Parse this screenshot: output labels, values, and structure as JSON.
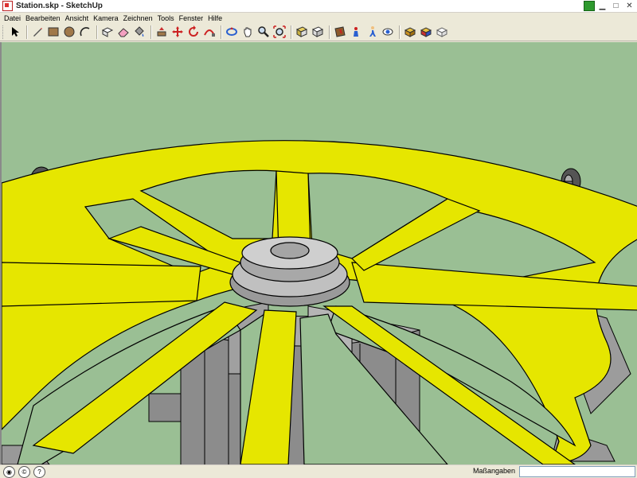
{
  "window": {
    "title": "Station.skp - SketchUp"
  },
  "menu": [
    "Datei",
    "Bearbeiten",
    "Ansicht",
    "Kamera",
    "Zeichnen",
    "Tools",
    "Fenster",
    "Hilfe"
  ],
  "toolbar": {
    "groups": [
      [
        "select-icon"
      ],
      [
        "pencil-icon",
        "rectangle-icon",
        "circle-icon",
        "arc-icon"
      ],
      [
        "make-component-icon",
        "eraser-icon",
        "paint-bucket-icon"
      ],
      [
        "push-pull-icon",
        "move-icon",
        "rotate-icon",
        "follow-me-icon"
      ],
      [
        "orbit-icon",
        "pan-icon",
        "zoom-icon",
        "zoom-extents-icon"
      ],
      [
        "get-models-icon",
        "share-model-icon"
      ],
      [
        "section-plane-icon",
        "position-camera-icon",
        "walk-icon",
        "look-around-icon"
      ],
      [
        "component-icon",
        "materials-icon",
        "styles-icon"
      ]
    ]
  },
  "statusbar": {
    "measurement_label": "Maßangaben",
    "measurement_value": "",
    "icons": [
      "geo-location-icon",
      "credits-icon",
      "help-icon"
    ]
  },
  "colors": {
    "sky": "#9abf94",
    "wheel_yellow": "#e6e600",
    "wheel_dark": "#b5b500",
    "steel": "#8c8c8c",
    "steel_light": "#b3b3b3",
    "panel_blue": "#6f6fc4"
  }
}
